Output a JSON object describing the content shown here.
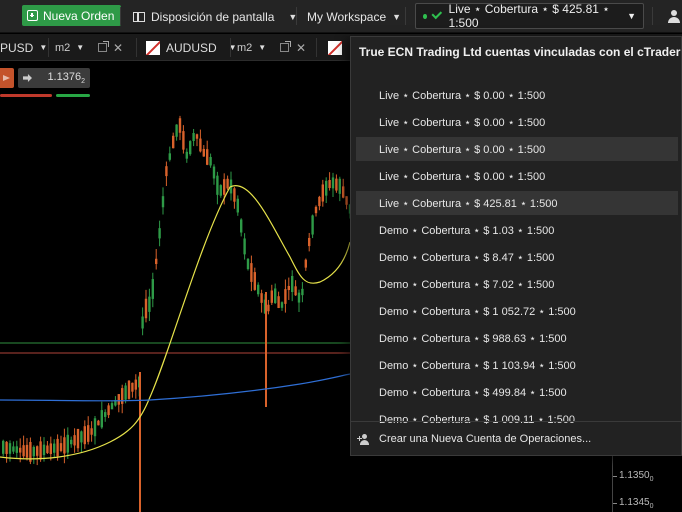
{
  "toolbar": {
    "new_order": "Nueva Orden",
    "layout": "Disposición de pantalla",
    "workspace": "My Workspace",
    "account": "Live ⋆ Cobertura ⋆ $ 425.81 ⋆ 1:500"
  },
  "tabs": [
    {
      "symbol": "PUSD",
      "timeframe": "m2"
    },
    {
      "symbol": "AUDUSD",
      "timeframe": "m2"
    }
  ],
  "trade_panel": {
    "buy_price": "1.1376",
    "buy_price_sup": "2"
  },
  "price_axis": [
    {
      "value": "1.1350",
      "sup": "0"
    },
    {
      "value": "1.1345",
      "sup": "0"
    }
  ],
  "dropdown": {
    "header": "True ECN Trading Ltd cuentas vinculadas con el cTrader ID",
    "accounts": [
      "Live ⋆ Cobertura ⋆ $ 0.00 ⋆ 1:500",
      "Live ⋆ Cobertura ⋆ $ 0.00 ⋆ 1:500",
      "Live ⋆ Cobertura ⋆ $ 0.00 ⋆ 1:500",
      "Live ⋆ Cobertura ⋆ $ 0.00 ⋆ 1:500",
      "Live ⋆ Cobertura ⋆ $ 425.81 ⋆ 1:500",
      "Demo ⋆ Cobertura ⋆ $ 1.03 ⋆ 1:500",
      "Demo ⋆ Cobertura ⋆ $ 8.47 ⋆ 1:500",
      "Demo ⋆ Cobertura ⋆ $ 7.02 ⋆ 1:500",
      "Demo ⋆ Cobertura ⋆ $ 1 052.72 ⋆ 1:500",
      "Demo ⋆ Cobertura ⋆ $ 988.63 ⋆ 1:500",
      "Demo ⋆ Cobertura ⋆ $ 1 103.94 ⋆ 1:500",
      "Demo ⋆ Cobertura ⋆ $ 499.84 ⋆ 1:500",
      "Demo ⋆ Cobertura ⋆ $ 1 009.11 ⋆ 1:500"
    ],
    "create": "Crear una Nueva Cuenta de Operaciones..."
  },
  "colors": {
    "accent_green": "#2e9a47",
    "bull": "#2e9a47",
    "bear": "#d9622b",
    "ma_yellow": "#e6e24a",
    "ma_blue": "#2f6fd6",
    "hline_green": "#2f8f3f",
    "hline_red": "#b0453a"
  }
}
